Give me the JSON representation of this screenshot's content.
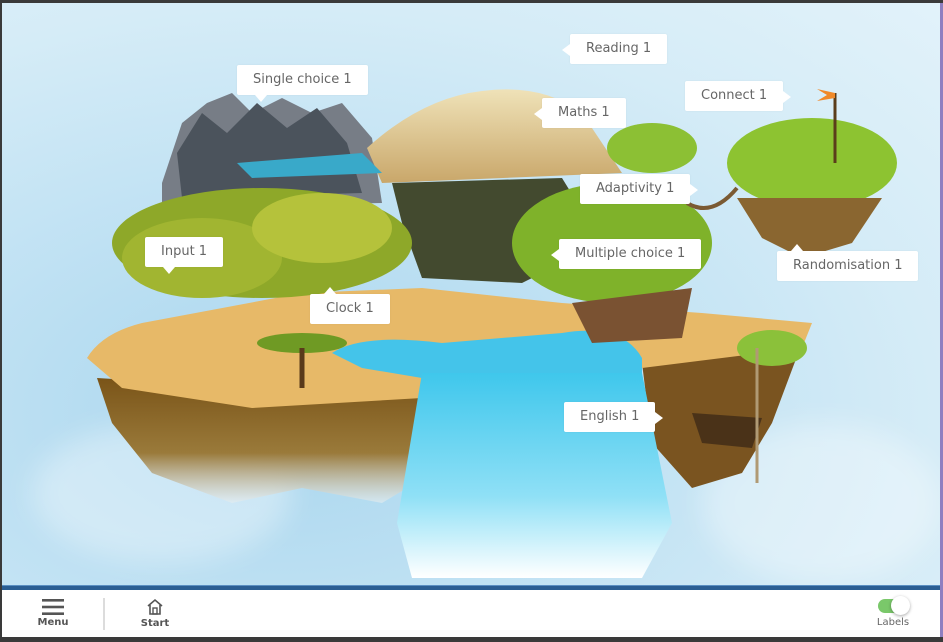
{
  "map_labels": {
    "reading": "Reading 1",
    "single_choice": "Single choice 1",
    "connect": "Connect 1",
    "maths": "Maths 1",
    "adaptivity": "Adaptivity 1",
    "input": "Input 1",
    "multiple_choice": "Multiple choice 1",
    "randomisation": "Randomisation 1",
    "clock": "Clock 1",
    "english": "English 1"
  },
  "bottom_bar": {
    "menu_label": "Menu",
    "start_label": "Start",
    "labels_toggle_label": "Labels",
    "labels_toggle_on": true
  },
  "colors": {
    "accent_bar": "#2b5e93",
    "toggle_on": "#7ac86a"
  }
}
